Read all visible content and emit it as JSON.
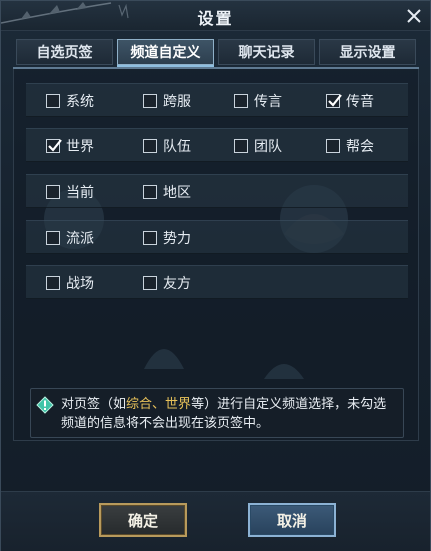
{
  "window": {
    "title": "设置"
  },
  "tabs": [
    {
      "label": "自选页签",
      "active": false
    },
    {
      "label": "频道自定义",
      "active": true
    },
    {
      "label": "聊天记录",
      "active": false
    },
    {
      "label": "显示设置",
      "active": false
    }
  ],
  "channels": [
    [
      {
        "label": "系统",
        "checked": false
      },
      {
        "label": "跨服",
        "checked": false
      },
      {
        "label": "传言",
        "checked": false
      },
      {
        "label": "传音",
        "checked": true
      }
    ],
    [
      {
        "label": "世界",
        "checked": true
      },
      {
        "label": "队伍",
        "checked": false
      },
      {
        "label": "团队",
        "checked": false
      },
      {
        "label": "帮会",
        "checked": false
      }
    ],
    [
      {
        "label": "当前",
        "checked": false
      },
      {
        "label": "地区",
        "checked": false
      }
    ],
    [
      {
        "label": "流派",
        "checked": false
      },
      {
        "label": "势力",
        "checked": false
      }
    ],
    [
      {
        "label": "战场",
        "checked": false
      },
      {
        "label": "友方",
        "checked": false
      }
    ]
  ],
  "notice": {
    "icon": "info-diamond-icon",
    "part1": "对页签（如",
    "hl1": "综合",
    "sep": "、",
    "hl2": "世界",
    "part2": "等）进行自定义频道选择，未勾选频道的信息将不会出现在该页签中。"
  },
  "buttons": {
    "ok": "确定",
    "cancel": "取消"
  },
  "colors": {
    "highlight": "#e8c25a",
    "ok_border": "#b89a5c",
    "cancel_border": "#8cb2d4"
  }
}
